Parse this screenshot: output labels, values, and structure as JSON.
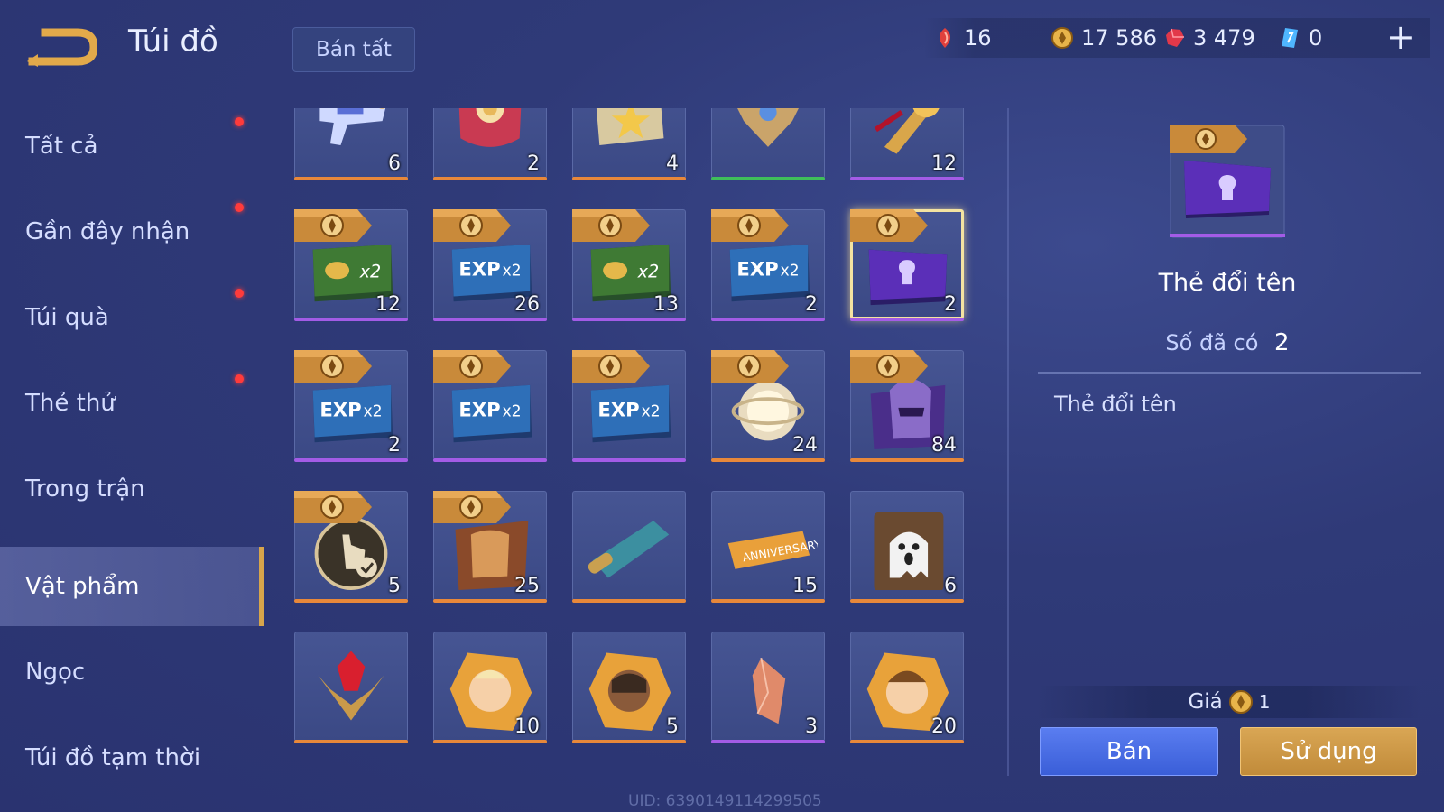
{
  "header": {
    "title": "Túi đồ",
    "sell_all_label": "Bán tất"
  },
  "currencies": [
    {
      "icon": "red-gem-icon",
      "value": "16"
    },
    {
      "icon": "gold-coin-icon",
      "value": "17 586"
    },
    {
      "icon": "ruby-icon",
      "value": "3 479"
    },
    {
      "icon": "blue-crystal-icon",
      "value": "0"
    }
  ],
  "plus_label": "+",
  "sidebar": {
    "items": [
      {
        "label": "Tất cả",
        "dot": true,
        "active": false
      },
      {
        "label": "Gần đây nhận",
        "dot": true,
        "active": false
      },
      {
        "label": "Túi quà",
        "dot": true,
        "active": false
      },
      {
        "label": "Thẻ thử",
        "dot": true,
        "active": false
      },
      {
        "label": "Trong trận",
        "dot": false,
        "active": false
      },
      {
        "label": "Vật phẩm",
        "dot": false,
        "active": true
      },
      {
        "label": "Ngọc",
        "dot": false,
        "active": false
      },
      {
        "label": "Túi đồ tạm thời",
        "dot": false,
        "active": false
      }
    ]
  },
  "rarity_colors": {
    "orange": "#e8883a",
    "purple": "#a35ce6",
    "green": "#3fbf5a"
  },
  "items": [
    {
      "name": "blaster-item",
      "count": "6",
      "rarity": "orange",
      "tag": false,
      "art": "blaster"
    },
    {
      "name": "gift-box-item",
      "count": "2",
      "rarity": "orange",
      "tag": false,
      "art": "gift"
    },
    {
      "name": "star-ticket-item",
      "count": "4",
      "rarity": "orange",
      "tag": false,
      "art": "star"
    },
    {
      "name": "emblem-item",
      "count": "",
      "rarity": "green",
      "tag": false,
      "art": "emblem"
    },
    {
      "name": "golden-weapon-item",
      "count": "12",
      "rarity": "purple",
      "tag": false,
      "art": "weapon"
    },
    {
      "name": "gold-x2-card",
      "count": "12",
      "rarity": "purple",
      "tag": true,
      "art": "goldx2"
    },
    {
      "name": "exp-x2-card",
      "count": "26",
      "rarity": "purple",
      "tag": true,
      "art": "expx2"
    },
    {
      "name": "gold-x2-card",
      "count": "13",
      "rarity": "purple",
      "tag": true,
      "art": "goldx2"
    },
    {
      "name": "exp-x2-card",
      "count": "2",
      "rarity": "purple",
      "tag": true,
      "art": "expx2"
    },
    {
      "name": "rename-card",
      "count": "2",
      "rarity": "purple",
      "tag": true,
      "art": "rename",
      "selected": true
    },
    {
      "name": "exp-x2-card",
      "count": "2",
      "rarity": "purple",
      "tag": true,
      "art": "expx2"
    },
    {
      "name": "exp-x2-card",
      "count": "",
      "rarity": "purple",
      "tag": true,
      "art": "expx2"
    },
    {
      "name": "exp-x2-card",
      "count": "",
      "rarity": "purple",
      "tag": true,
      "art": "expx2"
    },
    {
      "name": "orb-item",
      "count": "24",
      "rarity": "orange",
      "tag": true,
      "art": "orb"
    },
    {
      "name": "helmet-card",
      "count": "84",
      "rarity": "orange",
      "tag": true,
      "art": "helmet"
    },
    {
      "name": "tap-check-item",
      "count": "5",
      "rarity": "orange",
      "tag": true,
      "art": "tap"
    },
    {
      "name": "armor-card",
      "count": "25",
      "rarity": "orange",
      "tag": true,
      "art": "armor"
    },
    {
      "name": "scroll-item",
      "count": "",
      "rarity": "orange",
      "tag": false,
      "art": "scroll"
    },
    {
      "name": "anniversary-ticket",
      "count": "15",
      "rarity": "orange",
      "tag": false,
      "art": "ticket"
    },
    {
      "name": "ghost-card",
      "count": "6",
      "rarity": "orange",
      "tag": false,
      "art": "ghost"
    },
    {
      "name": "red-gem-crest",
      "count": "",
      "rarity": "orange",
      "tag": false,
      "art": "gemcrest"
    },
    {
      "name": "hero-fragment",
      "count": "10",
      "rarity": "orange",
      "tag": false,
      "art": "hero1"
    },
    {
      "name": "hero-fragment",
      "count": "5",
      "rarity": "orange",
      "tag": false,
      "art": "hero2"
    },
    {
      "name": "crystal-shard",
      "count": "3",
      "rarity": "purple",
      "tag": false,
      "art": "shard"
    },
    {
      "name": "hero-fragment",
      "count": "20",
      "rarity": "orange",
      "tag": false,
      "art": "hero3"
    }
  ],
  "detail": {
    "name": "Thẻ đổi tên",
    "owned_label": "Số đã có",
    "owned_value": "2",
    "description": "Thẻ đổi tên",
    "price_label": "Giá",
    "price_value": "1",
    "sell_label": "Bán",
    "use_label": "Sử dụng"
  },
  "uid": "UID: 6390149114299505"
}
